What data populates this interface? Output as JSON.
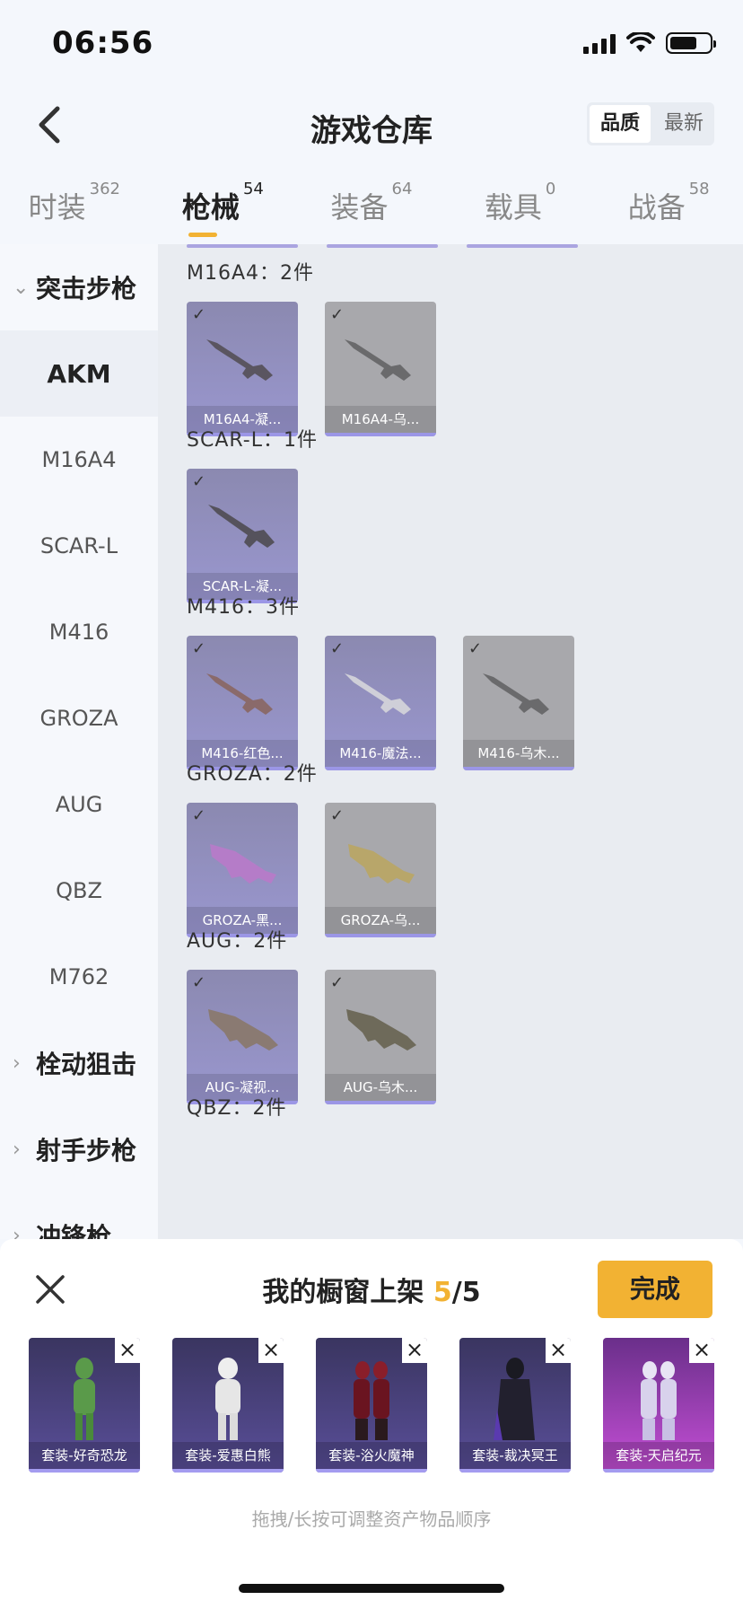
{
  "status": {
    "time": "06:56"
  },
  "header": {
    "title": "游戏仓库",
    "sort_quality": "品质",
    "sort_newest": "最新"
  },
  "tabs": [
    {
      "label": "时装",
      "count": "362"
    },
    {
      "label": "枪械",
      "count": "54"
    },
    {
      "label": "装备",
      "count": "64"
    },
    {
      "label": "载具",
      "count": "0"
    },
    {
      "label": "战备",
      "count": "58"
    }
  ],
  "sidebar": {
    "group_assault": "突击步枪",
    "items": [
      "AKM",
      "M16A4",
      "SCAR-L",
      "M416",
      "GROZA",
      "AUG",
      "QBZ",
      "M762"
    ],
    "group_bolt": "栓动狙击",
    "group_marksman": "射手步枪",
    "group_smg": "冲锋枪"
  },
  "sections": [
    {
      "title": "M16A4：2件",
      "cards": [
        "M16A4-凝...",
        "M16A4-乌..."
      ]
    },
    {
      "title": "SCAR-L：1件",
      "cards": [
        "SCAR-L-凝..."
      ]
    },
    {
      "title": "M416：3件",
      "cards": [
        "M416-红色...",
        "M416-魔法...",
        "M416-乌木..."
      ]
    },
    {
      "title": "GROZA：2件",
      "cards": [
        "GROZA-黑...",
        "GROZA-乌..."
      ]
    },
    {
      "title": "AUG：2件",
      "cards": [
        "AUG-凝视...",
        "AUG-乌木..."
      ]
    },
    {
      "title": "QBZ：2件"
    }
  ],
  "panel": {
    "title_prefix": "我的橱窗上架 ",
    "count_current": "5",
    "count_total": "/5",
    "done_label": "完成",
    "items": [
      "套装-好奇恐龙",
      "套装-爱惠白熊",
      "套装-浴火魔神",
      "套装-裁决冥王",
      "套装-天启纪元"
    ],
    "hint": "拖拽/长按可调整资产物品顺序"
  },
  "colors": {
    "accent": "#f2b233",
    "card_purple": "#9a97d0",
    "card_gray": "#a8a8ac"
  }
}
